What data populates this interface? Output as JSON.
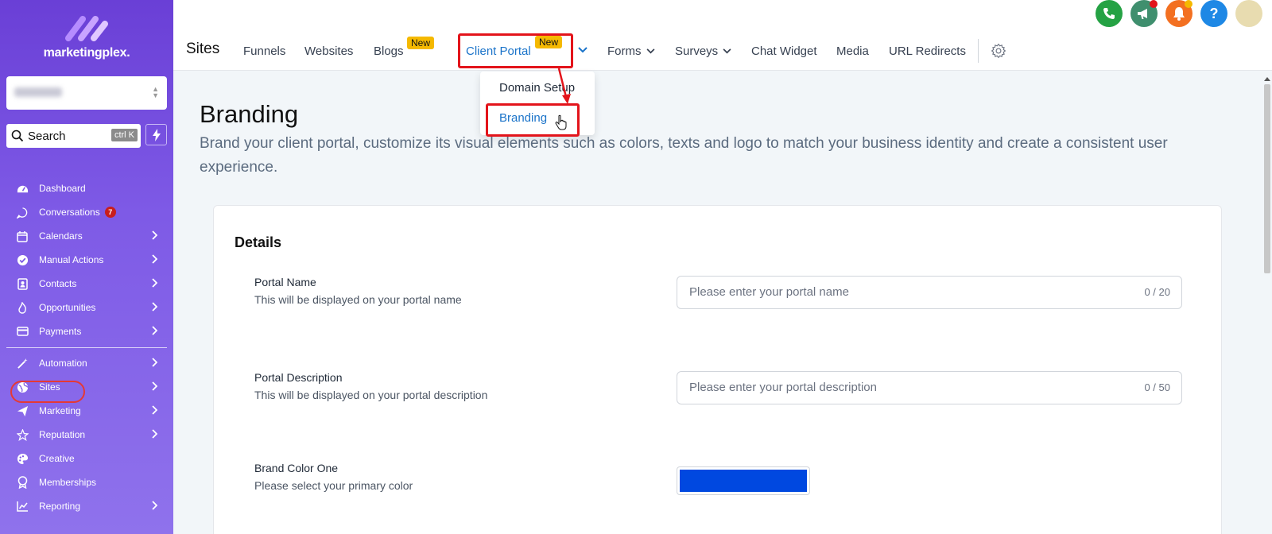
{
  "sidebar": {
    "logo_text": "marketingplex.",
    "search": {
      "label": "Search",
      "shortcut": "ctrl K"
    },
    "items": [
      {
        "label": "Dashboard",
        "icon": "dashboard-icon",
        "chevron": false
      },
      {
        "label": "Conversations",
        "icon": "chat-icon",
        "chevron": false,
        "badge": "7"
      },
      {
        "label": "Calendars",
        "icon": "calendar-icon",
        "chevron": true
      },
      {
        "label": "Manual Actions",
        "icon": "check-circle-icon",
        "chevron": true
      },
      {
        "label": "Contacts",
        "icon": "contacts-icon",
        "chevron": true
      },
      {
        "label": "Opportunities",
        "icon": "flame-icon",
        "chevron": true
      },
      {
        "label": "Payments",
        "icon": "card-icon",
        "chevron": true
      }
    ],
    "items2": [
      {
        "label": "Automation",
        "icon": "wand-icon",
        "chevron": true
      },
      {
        "label": "Sites",
        "icon": "globe-icon",
        "chevron": true
      },
      {
        "label": "Marketing",
        "icon": "send-icon",
        "chevron": true
      },
      {
        "label": "Reputation",
        "icon": "star-icon",
        "chevron": true
      },
      {
        "label": "Creative",
        "icon": "palette-icon",
        "chevron": false
      },
      {
        "label": "Memberships",
        "icon": "award-icon",
        "chevron": false
      },
      {
        "label": "Reporting",
        "icon": "chart-icon",
        "chevron": true
      }
    ]
  },
  "topbar": {
    "title": "Sites",
    "tabs": {
      "funnels": "Funnels",
      "websites": "Websites",
      "blogs": "Blogs",
      "client_portal": "Client Portal",
      "forms": "Forms",
      "surveys": "Surveys",
      "chat_widget": "Chat Widget",
      "media": "Media",
      "url_redirects": "URL Redirects"
    },
    "new_badge": "New"
  },
  "dropdown": {
    "domain_setup": "Domain Setup",
    "branding": "Branding"
  },
  "main": {
    "title": "Branding",
    "description": "Brand your client portal, customize its visual elements such as colors, texts and logo to match your business identity and create a consistent user experience.",
    "card_title": "Details",
    "portal_name": {
      "label": "Portal Name",
      "help": "This will be displayed on your portal name",
      "placeholder": "Please enter your portal name",
      "counter": "0 / 20"
    },
    "portal_description": {
      "label": "Portal Description",
      "help": "This will be displayed on your portal description",
      "placeholder": "Please enter your portal description",
      "counter": "0 / 50"
    },
    "brand_color_one": {
      "label": "Brand Color One",
      "help": "Please select your primary color",
      "color": "#0048e0"
    }
  },
  "colors": {
    "accent": "#1a73c9",
    "highlight": "#e3141b",
    "phone": "#25a244",
    "megaphone": "#3f8f6e",
    "bell": "#f37021",
    "help": "#1e88e5"
  }
}
